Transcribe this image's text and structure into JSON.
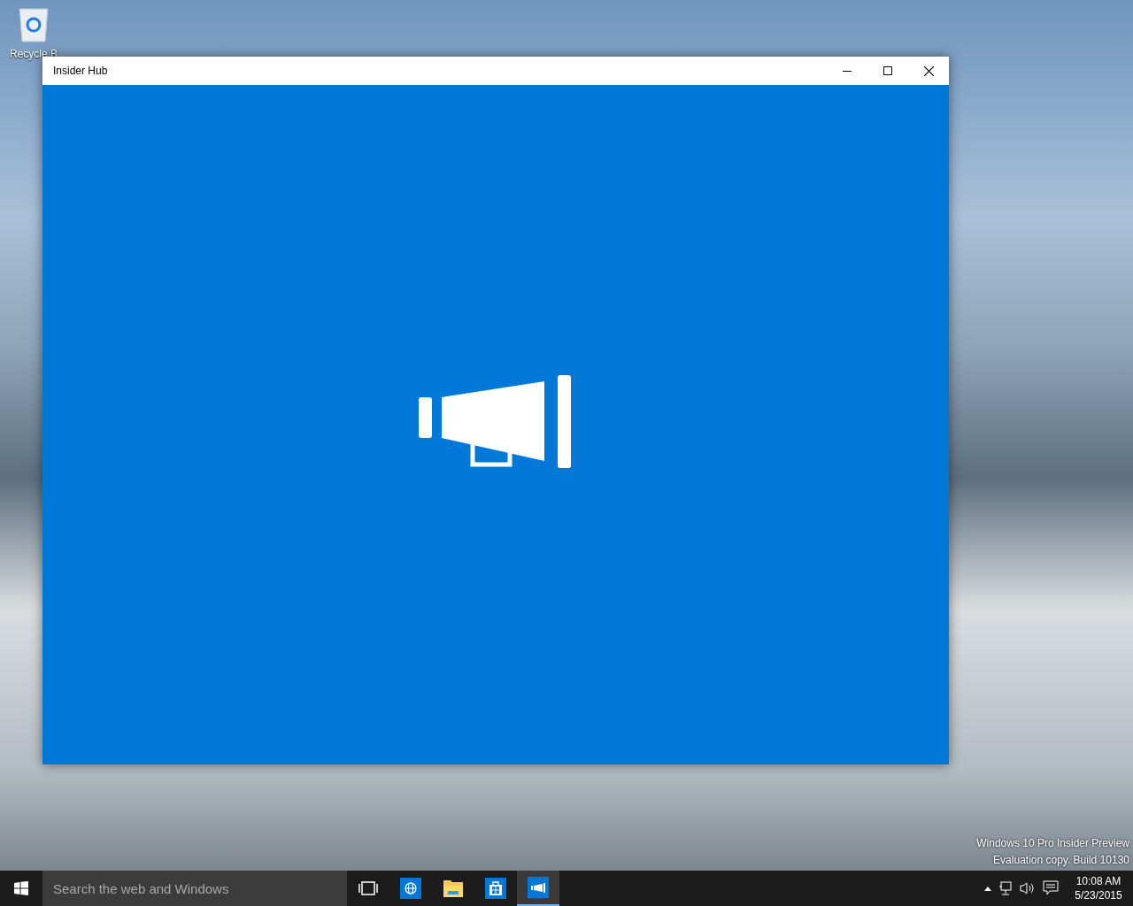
{
  "desktop": {
    "icons": [
      {
        "label": "Recycle B"
      }
    ],
    "build_info": [
      "Windows 10 Pro Insider Preview",
      "Evaluation copy. Build 10130"
    ]
  },
  "window": {
    "title": "Insider Hub"
  },
  "taskbar": {
    "search": {
      "placeholder": "Search the web and Windows"
    },
    "apps": [
      {
        "kind": "task-view",
        "selected": false
      },
      {
        "kind": "browser",
        "selected": false
      },
      {
        "kind": "folder",
        "selected": false
      },
      {
        "kind": "store",
        "selected": false
      },
      {
        "kind": "megaphone",
        "selected": true
      }
    ],
    "clock": {
      "time": "10:08 AM",
      "date": "5/23/2015"
    }
  }
}
